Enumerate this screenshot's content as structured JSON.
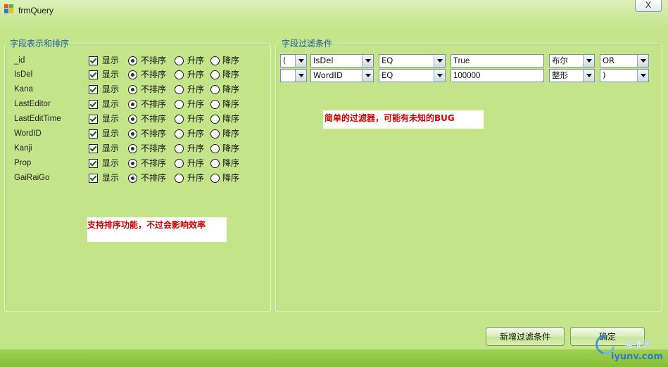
{
  "window": {
    "title": "frmQuery",
    "close_label": "X"
  },
  "sort_group": {
    "title": "字段表示和排序",
    "show_label": "显示",
    "options": [
      "不排序",
      "升序",
      "降序"
    ],
    "rows": [
      {
        "field": "_id",
        "show": true,
        "sort": 0
      },
      {
        "field": "IsDel",
        "show": true,
        "sort": 0
      },
      {
        "field": "Kana",
        "show": true,
        "sort": 0
      },
      {
        "field": "LastEditor",
        "show": true,
        "sort": 0
      },
      {
        "field": "LastEditTime",
        "show": true,
        "sort": 0
      },
      {
        "field": "WordID",
        "show": true,
        "sort": 0
      },
      {
        "field": "Kanji",
        "show": true,
        "sort": 0
      },
      {
        "field": "Prop",
        "show": true,
        "sort": 0
      },
      {
        "field": "GaiRaiGo",
        "show": true,
        "sort": 0
      }
    ],
    "note": "支持排序功能，不过会影响效率"
  },
  "filter_group": {
    "title": "字段过滤条件",
    "rows": [
      {
        "open": "(",
        "field": "IsDel",
        "op": "EQ",
        "value": "True",
        "type": "布尔",
        "logic": "OR"
      },
      {
        "open": "",
        "field": "WordID",
        "op": "EQ",
        "value": "100000",
        "type": "整形",
        "logic": ")"
      }
    ],
    "note": "简单的过滤器，可能有未知的BUG"
  },
  "buttons": {
    "add_filter": "新增过滤条件",
    "ok": "确定"
  },
  "watermark": {
    "name": "运维网",
    "site": "iyunv.com"
  },
  "colors": {
    "background": "#c4e48a",
    "group_title": "#1f5ba6",
    "note_text": "#d40000",
    "bottom_strip": "#8cc540"
  }
}
